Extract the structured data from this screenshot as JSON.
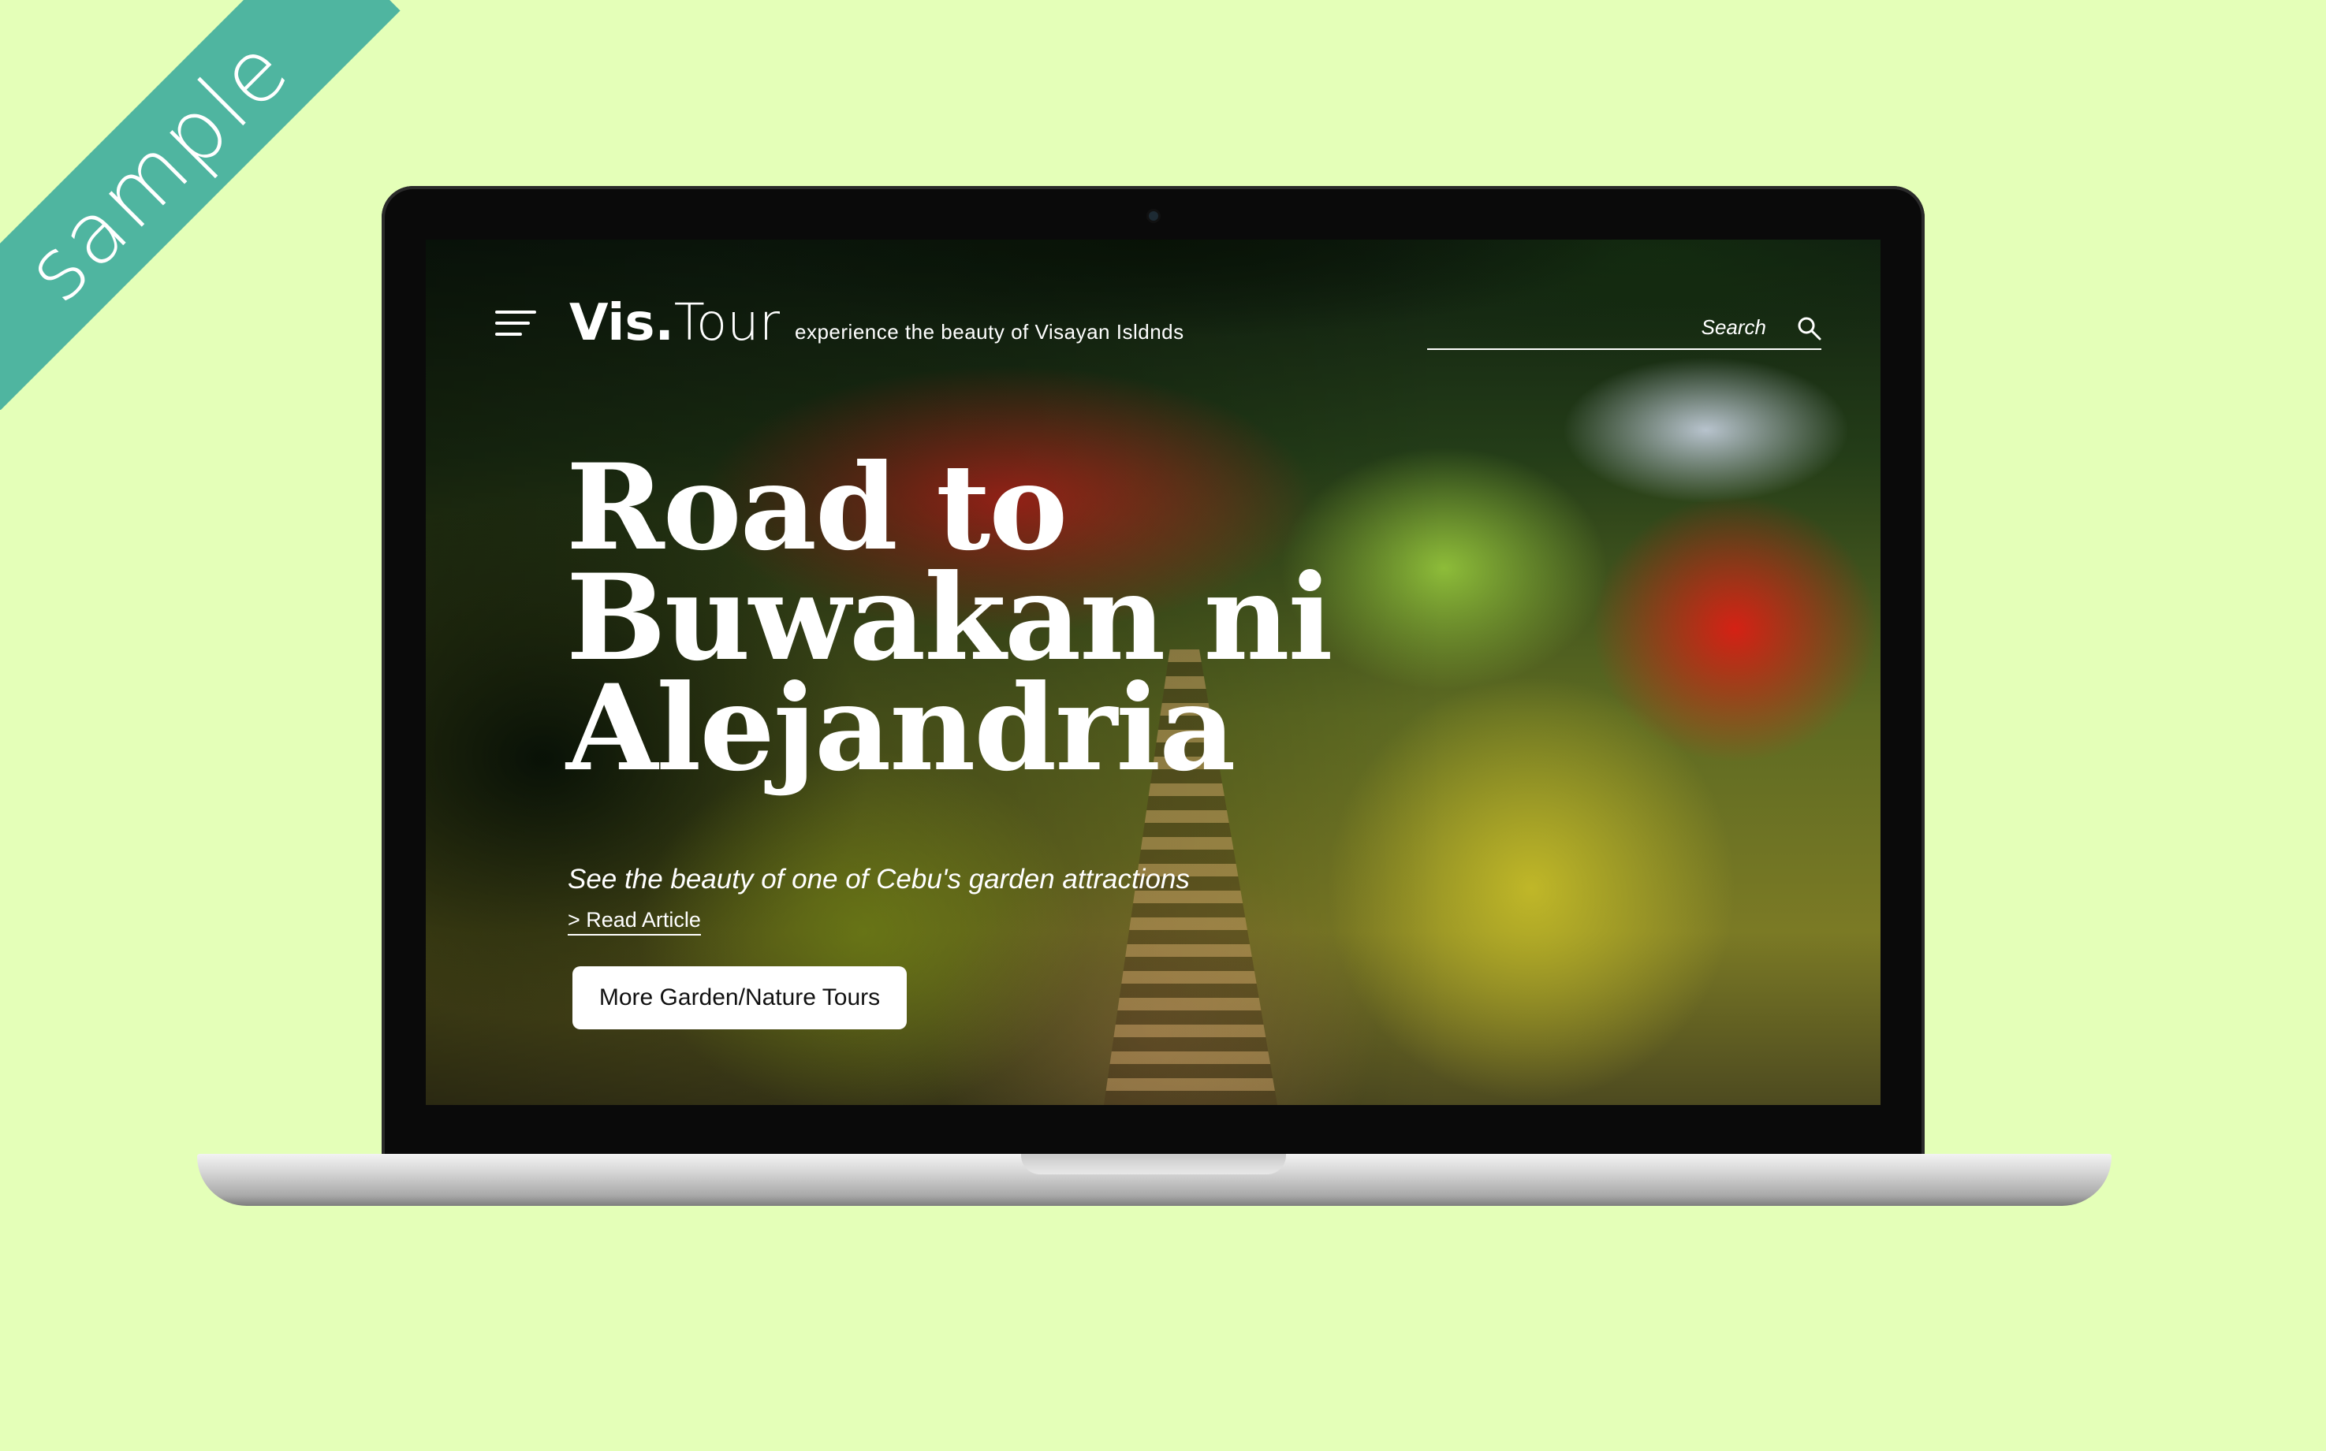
{
  "ribbon": {
    "label": "sample",
    "color": "#4fb5a0"
  },
  "page": {
    "background": "#e4ffb8"
  },
  "header": {
    "menu_icon": "hamburger-menu-icon",
    "logo_bold": "Vis.",
    "logo_light": "Tour",
    "tagline": "experience the beauty of Visayan Isldnds",
    "search": {
      "placeholder": "Search",
      "icon": "magnifier-icon"
    }
  },
  "hero": {
    "headline_lines": [
      "Road to",
      "Buwakan ni",
      "Alejandria"
    ],
    "subtitle": "See the beauty of one of Cebu's garden attractions",
    "read_link": "> Read Article",
    "cta_button": "More Garden/Nature Tours",
    "background_image": "flower garden with stone stairway"
  }
}
